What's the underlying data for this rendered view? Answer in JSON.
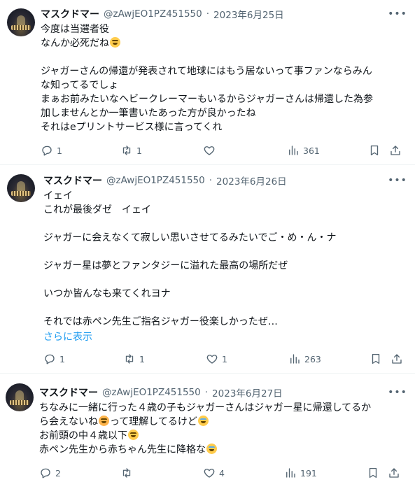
{
  "tweets": [
    {
      "name": "マスクドマー",
      "handle": "@zAwjEO1PZ451550",
      "dot": "·",
      "date": "2023年6月25日",
      "lines": [
        "今度は当選者役",
        "なんか必死だね",
        "",
        "ジャガーさんの帰還が発表されて地球にはもう居ないって事ファンならみん",
        "な知ってるでしょ",
        "まぁお前みたいなヘビークレーマーもいるからジャガーさんは帰還した為参",
        "加しませんとか一筆書いたあった方が良かったね",
        "それはeプリントサービス様に言ってくれ"
      ],
      "emoji_after_line": 1,
      "reply_count": "1",
      "retweet_count": "1",
      "like_count": "",
      "view_count": "361"
    },
    {
      "name": "マスクドマー",
      "handle": "@zAwjEO1PZ451550",
      "dot": "·",
      "date": "2023年6月26日",
      "lines": [
        "イェイ",
        "これが最後ダゼ　イェイ",
        "",
        "ジャガーに会えなくて寂しい思いさせてるみたいでご・め・ん・ナ",
        "",
        "ジャガー星は夢とファンタジーに溢れた最高の場所だぜ",
        "",
        "いつか皆んなも来てくれヨナ",
        "",
        "それでは赤ペン先生ご指名ジャガー役楽しかったぜ…"
      ],
      "show_more": "さらに表示",
      "reply_count": "1",
      "retweet_count": "1",
      "like_count": "1",
      "view_count": "263"
    },
    {
      "name": "マスクドマー",
      "handle": "@zAwjEO1PZ451550",
      "dot": "·",
      "date": "2023年6月27日",
      "lines": [
        "ちなみに一緒に行った４歳の子もジャガーさんはジャガー星に帰還してるか",
        "ら会えないね",
        "お前頭の中４歳以下",
        "赤ペン先生から赤ちゃん先生に降格な"
      ],
      "line2_suffix": "って理解してるけど",
      "reply_count": "2",
      "retweet_count": "",
      "like_count": "4",
      "view_count": "191"
    }
  ],
  "icons": {
    "more": "more-horizontal-icon",
    "reply": "reply-bubble-icon",
    "retweet": "retweet-arrows-icon",
    "like": "heart-icon",
    "views": "bar-chart-icon",
    "bookmark": "bookmark-icon",
    "share": "share-upload-icon"
  },
  "colors": {
    "link": "#1d9bf0",
    "muted": "#536471",
    "text": "#0f1419"
  }
}
